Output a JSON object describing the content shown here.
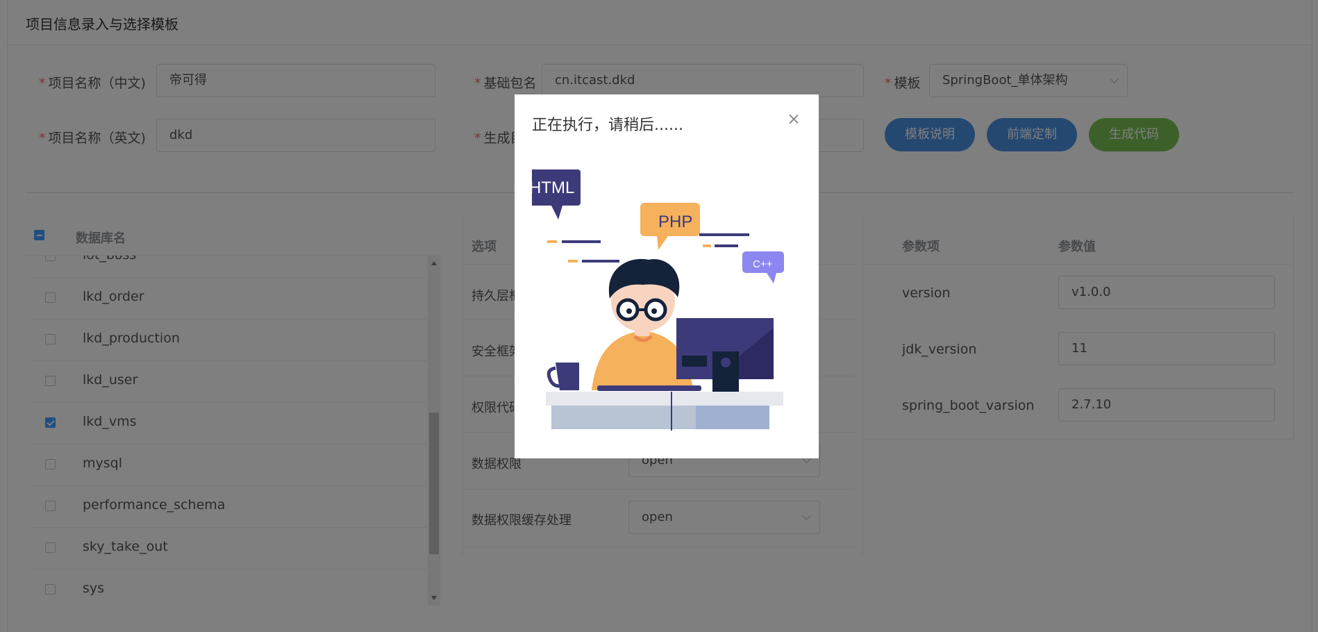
{
  "card": {
    "title": "项目信息录入与选择模板"
  },
  "form": {
    "required_mark": "*",
    "name_cn": {
      "label": "项目名称（中文)",
      "value": "帝可得"
    },
    "name_en": {
      "label": "项目名称（英文)",
      "value": "dkd"
    },
    "base_pkg": {
      "label": "基础包名",
      "value": "cn.itcast.dkd"
    },
    "gen_dir": {
      "label": "生成目"
    },
    "template": {
      "label": "模板",
      "value": "SpringBoot_单体架构"
    }
  },
  "buttons": {
    "template_doc": "模板说明",
    "frontend": "前端定制",
    "generate": "生成代码"
  },
  "db_table": {
    "header": "数据库名",
    "rows": [
      {
        "name": "iot_boss",
        "checked": false
      },
      {
        "name": "lkd_order",
        "checked": false
      },
      {
        "name": "lkd_production",
        "checked": false
      },
      {
        "name": "lkd_user",
        "checked": false
      },
      {
        "name": "lkd_vms",
        "checked": true
      },
      {
        "name": "mysql",
        "checked": false
      },
      {
        "name": "performance_schema",
        "checked": false
      },
      {
        "name": "sky_take_out",
        "checked": false
      },
      {
        "name": "sys",
        "checked": false
      }
    ]
  },
  "options": {
    "header": "选项",
    "rows": [
      {
        "label": "持久层框"
      },
      {
        "label": "安全框架"
      },
      {
        "label": "权限代码"
      },
      {
        "label": "数据权限",
        "value": "open"
      },
      {
        "label": "数据权限缓存处理",
        "value": "open"
      }
    ]
  },
  "params": {
    "header_key": "参数项",
    "header_val": "参数值",
    "rows": [
      {
        "key": "version",
        "value": "v1.0.0"
      },
      {
        "key": "jdk_version",
        "value": "11"
      },
      {
        "key": "spring_boot_varsion",
        "value": "2.7.10"
      }
    ]
  },
  "dialog": {
    "title": "正在执行，请稍后......",
    "bubble_html": "HTML",
    "bubble_php": "PHP",
    "bubble_cpp": "C++"
  },
  "colors": {
    "primary": "#4a90e2",
    "success": "#7bc154",
    "overlay": "rgba(0,0,0,0.5)"
  }
}
